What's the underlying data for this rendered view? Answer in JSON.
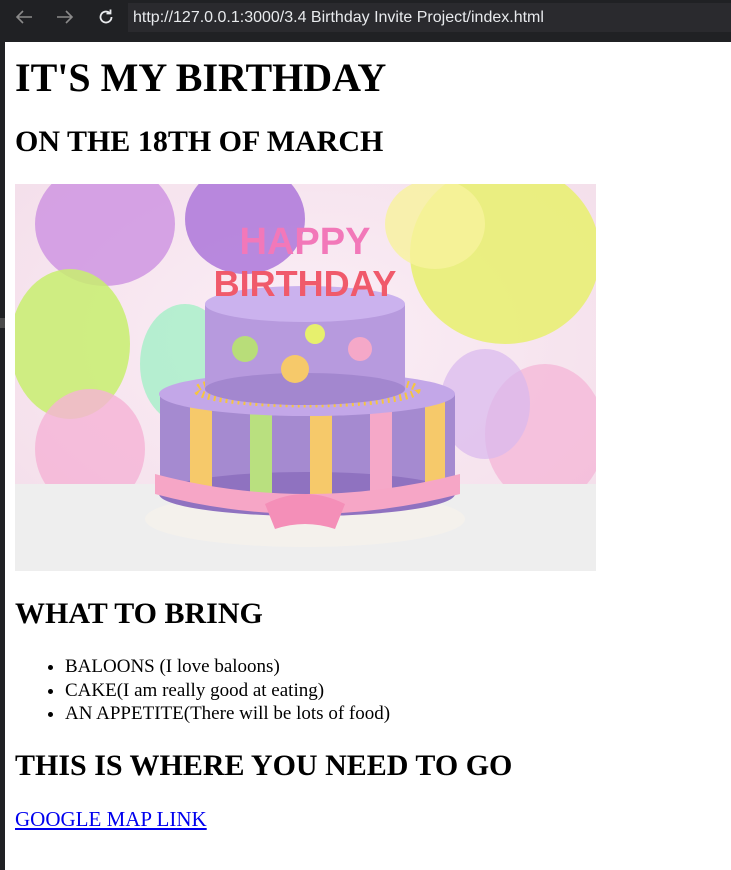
{
  "browser": {
    "url": "http://127.0.0.1:3000/3.4 Birthday Invite Project/index.html",
    "back_icon": "arrow-left-icon",
    "forward_icon": "arrow-right-icon",
    "reload_icon": "reload-icon"
  },
  "page": {
    "title": "IT'S MY BIRTHDAY",
    "date_heading": "ON THE 18TH OF MARCH",
    "cake_image_text": {
      "line1": "HAPPY",
      "line2": "BIRTHDAY"
    },
    "bring_heading": "WHAT TO BRING",
    "bring_items": [
      "BALOONS (I love baloons)",
      "CAKE(I am really good at eating)",
      "AN APPETITE(There will be lots of food)"
    ],
    "where_heading": "THIS IS WHERE YOU NEED TO GO",
    "map_link": "GOOGLE MAP LINK"
  },
  "colors": {
    "chrome_bg": "#202124",
    "link": "#0000ee"
  }
}
